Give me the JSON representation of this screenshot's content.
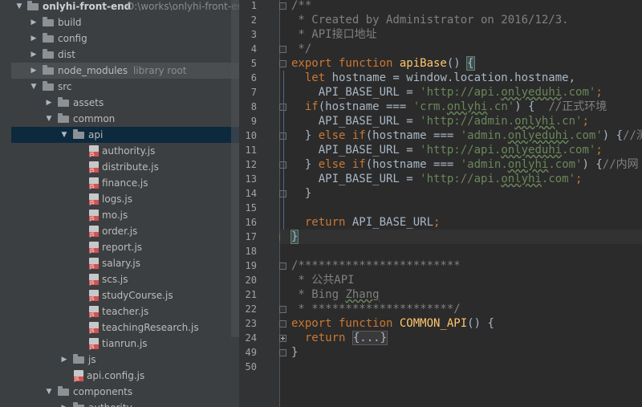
{
  "project": {
    "root_name": "onlyhi-front-end",
    "root_path": "D:\\works\\onlyhi-front-end",
    "items": [
      {
        "label": "build",
        "type": "folder",
        "depth": 1,
        "state": "collapsed"
      },
      {
        "label": "config",
        "type": "folder",
        "depth": 1,
        "state": "collapsed"
      },
      {
        "label": "dist",
        "type": "folder",
        "depth": 1,
        "state": "collapsed"
      },
      {
        "label": "node_modules",
        "extra": "library root",
        "type": "folder",
        "depth": 1,
        "state": "collapsed"
      },
      {
        "label": "src",
        "type": "folder",
        "depth": 1,
        "state": "expanded"
      },
      {
        "label": "assets",
        "type": "folder",
        "depth": 2,
        "state": "collapsed"
      },
      {
        "label": "common",
        "type": "folder",
        "depth": 2,
        "state": "expanded"
      },
      {
        "label": "api",
        "type": "folder",
        "depth": 3,
        "state": "expanded",
        "selected": true
      },
      {
        "label": "authority.js",
        "type": "js",
        "depth": 4
      },
      {
        "label": "distribute.js",
        "type": "js",
        "depth": 4
      },
      {
        "label": "finance.js",
        "type": "js",
        "depth": 4
      },
      {
        "label": "logs.js",
        "type": "js",
        "depth": 4
      },
      {
        "label": "mo.js",
        "type": "js",
        "depth": 4
      },
      {
        "label": "order.js",
        "type": "js",
        "depth": 4
      },
      {
        "label": "report.js",
        "type": "js",
        "depth": 4
      },
      {
        "label": "salary.js",
        "type": "js",
        "depth": 4
      },
      {
        "label": "scs.js",
        "type": "js",
        "depth": 4
      },
      {
        "label": "studyCourse.js",
        "type": "js",
        "depth": 4
      },
      {
        "label": "teacher.js",
        "type": "js",
        "depth": 4
      },
      {
        "label": "teachingResearch.js",
        "type": "js",
        "depth": 4
      },
      {
        "label": "tianrun.js",
        "type": "js",
        "depth": 4
      },
      {
        "label": "js",
        "type": "folder",
        "depth": 3,
        "state": "collapsed"
      },
      {
        "label": "api.config.js",
        "type": "js",
        "depth": 3
      },
      {
        "label": "components",
        "type": "folder",
        "depth": 2,
        "state": "expanded"
      },
      {
        "label": "authority",
        "type": "folder",
        "depth": 3,
        "state": "collapsed"
      }
    ]
  },
  "editor": {
    "current_line": "17",
    "lines": [
      {
        "n": "1",
        "fold": "top",
        "parts": [
          [
            "cm",
            "/**"
          ]
        ]
      },
      {
        "n": "2",
        "parts": [
          [
            "cm",
            " * Created by Administrator on 2016/12/3."
          ]
        ]
      },
      {
        "n": "3",
        "parts": [
          [
            "cm",
            " * API接口地址"
          ]
        ]
      },
      {
        "n": "4",
        "fold": "bottom",
        "parts": [
          [
            "cm",
            " */"
          ]
        ]
      },
      {
        "n": "5",
        "fold": "top",
        "parts": [
          [
            "kw",
            "export function "
          ],
          [
            "fn",
            "apiBase"
          ],
          [
            "",
            "() "
          ],
          [
            "hl",
            "{"
          ]
        ]
      },
      {
        "n": "6",
        "parts": [
          [
            "",
            "  "
          ],
          [
            "kw",
            "let "
          ],
          [
            "",
            "hostname = window.location.hostname,"
          ]
        ]
      },
      {
        "n": "7",
        "parts": [
          [
            "",
            "    API_BASE_URL = "
          ],
          [
            "str",
            "'http://api."
          ],
          [
            "strw",
            "onlyeduhi"
          ],
          [
            "str",
            ".com'"
          ],
          [
            "kw",
            ";"
          ]
        ]
      },
      {
        "n": "8",
        "fold": "top",
        "parts": [
          [
            "",
            "  "
          ],
          [
            "kw",
            "if"
          ],
          [
            "",
            "(hostname === "
          ],
          [
            "str",
            "'crm."
          ],
          [
            "strw",
            "onlyhi"
          ],
          [
            "str",
            ".cn'"
          ],
          [
            "",
            ") {  "
          ],
          [
            "cm",
            "//正式环境"
          ]
        ]
      },
      {
        "n": "9",
        "parts": [
          [
            "",
            "    API_BASE_URL = "
          ],
          [
            "str",
            "'http://admin."
          ],
          [
            "strw",
            "onlyhi"
          ],
          [
            "str",
            ".cn'"
          ],
          [
            "kw",
            ";"
          ]
        ]
      },
      {
        "n": "10",
        "fold": "mid",
        "parts": [
          [
            "",
            "  } "
          ],
          [
            "kw",
            "else if"
          ],
          [
            "",
            "(hostname === "
          ],
          [
            "str",
            "'admin."
          ],
          [
            "strw",
            "onlyeduhi"
          ],
          [
            "str",
            ".com'"
          ],
          [
            "",
            ") {"
          ],
          [
            "cm",
            "//测"
          ]
        ]
      },
      {
        "n": "11",
        "parts": [
          [
            "",
            "    API_BASE_URL = "
          ],
          [
            "str",
            "'http://api."
          ],
          [
            "strw",
            "onlyeduhi"
          ],
          [
            "str",
            ".com'"
          ],
          [
            "kw",
            ";"
          ]
        ]
      },
      {
        "n": "12",
        "fold": "mid",
        "parts": [
          [
            "",
            "  } "
          ],
          [
            "kw",
            "else if"
          ],
          [
            "",
            "(hostname === "
          ],
          [
            "str",
            "'admin."
          ],
          [
            "strw",
            "onlyhi"
          ],
          [
            "str",
            ".com'"
          ],
          [
            "",
            ") {"
          ],
          [
            "cm",
            "//内网"
          ]
        ]
      },
      {
        "n": "13",
        "parts": [
          [
            "",
            "    API_BASE_URL = "
          ],
          [
            "str",
            "'http://api."
          ],
          [
            "strw",
            "onlyhi"
          ],
          [
            "str",
            ".com'"
          ],
          [
            "kw",
            ";"
          ]
        ]
      },
      {
        "n": "14",
        "fold": "bottom",
        "parts": [
          [
            "",
            "  }"
          ]
        ]
      },
      {
        "n": "15",
        "parts": []
      },
      {
        "n": "16",
        "parts": [
          [
            "",
            "  "
          ],
          [
            "kw",
            "return "
          ],
          [
            "",
            "API_BASE_URL"
          ],
          [
            "kw",
            ";"
          ]
        ]
      },
      {
        "n": "17",
        "fold": "bottom",
        "parts": [
          [
            "hl",
            "}"
          ]
        ]
      },
      {
        "n": "18",
        "parts": []
      },
      {
        "n": "19",
        "fold": "top",
        "parts": [
          [
            "cm",
            "/************************"
          ]
        ]
      },
      {
        "n": "20",
        "parts": [
          [
            "cm",
            " * 公共API"
          ]
        ]
      },
      {
        "n": "21",
        "parts": [
          [
            "cm",
            " * Bing "
          ],
          [
            "cmw",
            "Zhang"
          ]
        ]
      },
      {
        "n": "22",
        "fold": "bottom",
        "parts": [
          [
            "cm",
            " * *********************/"
          ]
        ]
      },
      {
        "n": "23",
        "fold": "top",
        "parts": [
          [
            "kw",
            "export function "
          ],
          [
            "fn",
            "COMMON_API"
          ],
          [
            "",
            "() {"
          ]
        ]
      },
      {
        "n": "24",
        "fold": "plus",
        "parts": [
          [
            "",
            "  "
          ],
          [
            "kw",
            "return "
          ],
          [
            "folded",
            "{...}"
          ]
        ]
      },
      {
        "n": "49",
        "fold": "bottom",
        "parts": [
          [
            "",
            "}"
          ]
        ]
      },
      {
        "n": "50",
        "parts": []
      }
    ]
  }
}
